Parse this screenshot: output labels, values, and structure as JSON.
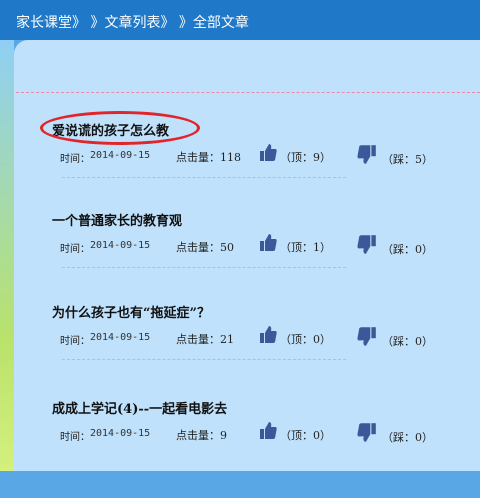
{
  "breadcrumb": {
    "part1": "家长课堂》",
    "part2": "》文章列表》",
    "part3": "》全部文章"
  },
  "labels": {
    "time": "时间：",
    "clicks": "点击量："
  },
  "articles": [
    {
      "title": "爱说谎的孩子怎么教",
      "date": "2014-09-15",
      "clicks": "118",
      "up": "（顶：9）",
      "down": "（踩：5）"
    },
    {
      "title": "一个普通家长的教育观",
      "date": "2014-09-15",
      "clicks": "50",
      "up": "（顶：1）",
      "down": "（踩：0）"
    },
    {
      "title": "为什么孩子也有“拖延症”？",
      "date": "2014-09-15",
      "clicks": "21",
      "up": "（顶：0）",
      "down": "（踩：0）"
    },
    {
      "title": "成成上学记(4)--一起看电影去",
      "date": "2014-09-15",
      "clicks": "9",
      "up": "（顶：0）",
      "down": "（踩：0）"
    }
  ],
  "colors": {
    "header": "#1f78c8",
    "panel": "#bfe1fb",
    "highlight": "#e0262b"
  }
}
